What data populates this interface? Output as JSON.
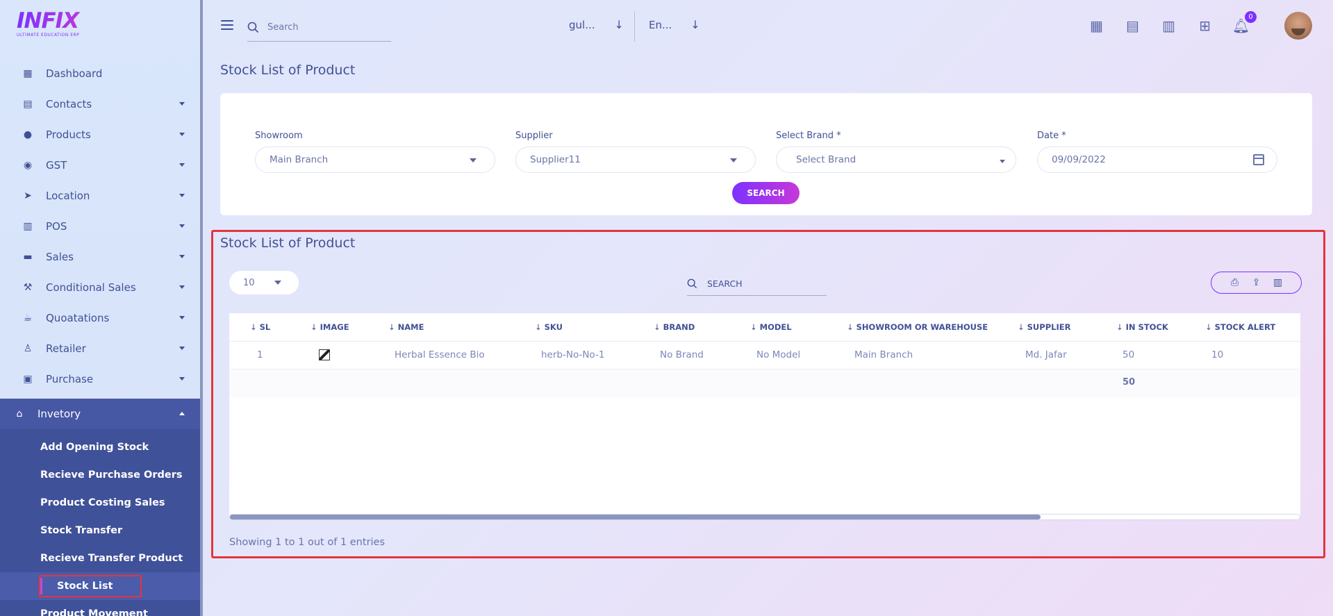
{
  "logo": {
    "main": "INFIX",
    "sub": "ULTIMATE EDUCATION ERP"
  },
  "sidebar": {
    "items": [
      {
        "label": "Dashboard",
        "icon": "grid-icon",
        "has_caret": false
      },
      {
        "label": "Contacts",
        "icon": "contacts-icon",
        "has_caret": true
      },
      {
        "label": "Products",
        "icon": "product-icon",
        "has_caret": true
      },
      {
        "label": "GST",
        "icon": "money-icon",
        "has_caret": true
      },
      {
        "label": "Location",
        "icon": "location-arrow-icon",
        "has_caret": true
      },
      {
        "label": "POS",
        "icon": "pos-icon",
        "has_caret": true
      },
      {
        "label": "Sales",
        "icon": "store-icon",
        "has_caret": true
      },
      {
        "label": "Conditional Sales",
        "icon": "hammer-icon",
        "has_caret": true
      },
      {
        "label": "Quoatations",
        "icon": "coffee-icon",
        "has_caret": true
      },
      {
        "label": "Retailer",
        "icon": "retailer-icon",
        "has_caret": true
      },
      {
        "label": "Purchase",
        "icon": "shop-icon",
        "has_caret": true
      }
    ],
    "active": {
      "label": "Invetory",
      "icon": "bank-icon"
    },
    "sub_items": [
      "Add Opening Stock",
      "Recieve Purchase Orders",
      "Product Costing Sales",
      "Stock Transfer",
      "Recieve Transfer Product",
      "Stock List",
      "Product Movement"
    ]
  },
  "topbar": {
    "search_placeholder": "Search",
    "school_select": "gul...",
    "language_select": "En...",
    "notification_count": "0"
  },
  "page_title": "Stock List of Product",
  "filters": {
    "showroom": {
      "label": "Showroom",
      "value": "Main Branch"
    },
    "supplier": {
      "label": "Supplier",
      "value": "Supplier11"
    },
    "brand": {
      "label": "Select Brand *",
      "value": "Select Brand"
    },
    "date": {
      "label": "Date *",
      "value": "09/09/2022"
    },
    "search_button": "SEARCH"
  },
  "stock_list": {
    "title": "Stock List of Product",
    "page_size": "10",
    "search_placeholder": "SEARCH",
    "columns": [
      "SL",
      "IMAGE",
      "NAME",
      "SKU",
      "BRAND",
      "MODEL",
      "SHOWROOM OR WAREHOUSE",
      "SUPPLIER",
      "IN STOCK",
      "STOCK ALERT"
    ],
    "rows": [
      {
        "sl": "1",
        "name": "Herbal Essence Bio",
        "sku": "herb-No-No-1",
        "brand": "No Brand",
        "model": "No Model",
        "showroom": "Main Branch",
        "supplier": "Md. Jafar",
        "in_stock": "50",
        "stock_alert": "10"
      }
    ],
    "total_in_stock": "50",
    "footer": "Showing 1 to 1 out of 1 entries",
    "horizontal_scroll_position": 0.76
  }
}
